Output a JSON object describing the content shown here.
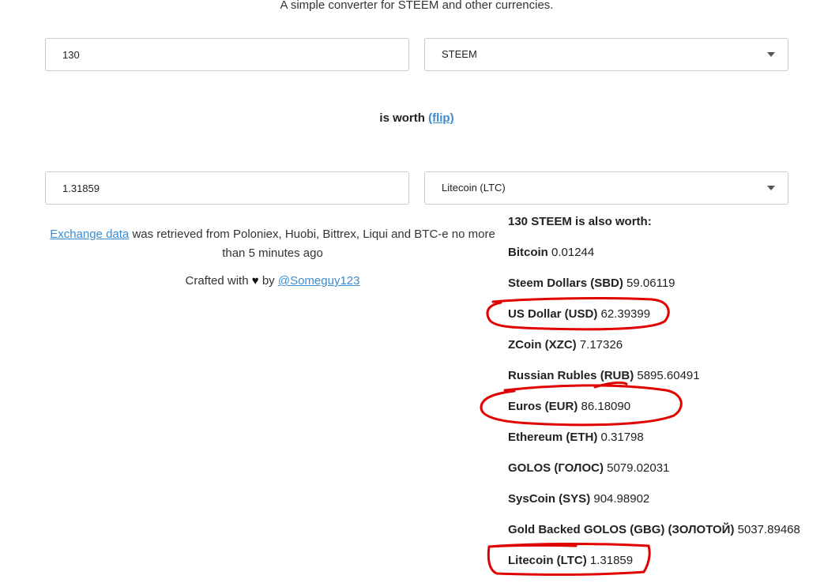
{
  "subtitle": "A simple converter for STEEM and other currencies.",
  "from": {
    "amount": "130",
    "currency": "STEEM"
  },
  "worth": {
    "label": "is worth",
    "flip": "(flip)"
  },
  "to": {
    "amount": "1.31859",
    "currency": "Litecoin (LTC)"
  },
  "info": {
    "link": "Exchange data",
    "text": "was retrieved from Poloniex, Huobi, Bittrex, Liqui and BTC-e no more than 5 minutes ago"
  },
  "crafted": {
    "prefix": "Crafted with",
    "by": "by",
    "author": "@Someguy123",
    "heart_icon": "heart-icon"
  },
  "also_worth": {
    "heading": "130 STEEM is also worth:",
    "rows": [
      {
        "name": "Bitcoin",
        "value": "0.01244"
      },
      {
        "name": "Steem Dollars (SBD)",
        "value": "59.06119"
      },
      {
        "name": "US Dollar (USD)",
        "value": "62.39399"
      },
      {
        "name": "ZCoin (XZC)",
        "value": "7.17326"
      },
      {
        "name": "Russian Rubles (RUB)",
        "value": "5895.60491"
      },
      {
        "name": "Euros (EUR)",
        "value": "86.18090"
      },
      {
        "name": "Ethereum (ETH)",
        "value": "0.31798"
      },
      {
        "name": "GOLOS (ГОЛОС)",
        "value": "5079.02031"
      },
      {
        "name": "SysCoin (SYS)",
        "value": "904.98902"
      },
      {
        "name": "Gold Backed GOLOS (GBG) (ЗОЛОТОЙ)",
        "value": "5037.89468"
      },
      {
        "name": "Litecoin (LTC)",
        "value": "1.31859"
      }
    ]
  },
  "annotation_color": "#e00000"
}
